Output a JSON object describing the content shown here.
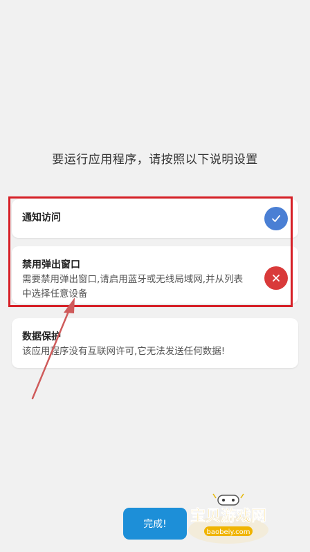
{
  "instruction": "要运行应用程序，请按照以下说明设置",
  "cards": [
    {
      "title": "通知访问",
      "description": "",
      "status": "done",
      "status_icon": "check-icon",
      "status_color": "#4a7fd4"
    },
    {
      "title": "禁用弹出窗口",
      "description": "需要禁用弹出窗口,请启用蓝牙或无线局域网,并从列表中选择任意设备",
      "status": "error",
      "status_icon": "close-icon",
      "status_color": "#d93a3a"
    },
    {
      "title": "数据保护",
      "description": "该应用程序没有互联网许可,它无法发送任何数据!",
      "status": "none"
    }
  ],
  "done_button": {
    "label": "完成!",
    "color": "#1d8fd8"
  },
  "annotation": {
    "highlight_color": "#d61f26"
  },
  "watermark": {
    "name": "宝贝游戏网",
    "url": "baobeiy.com"
  }
}
